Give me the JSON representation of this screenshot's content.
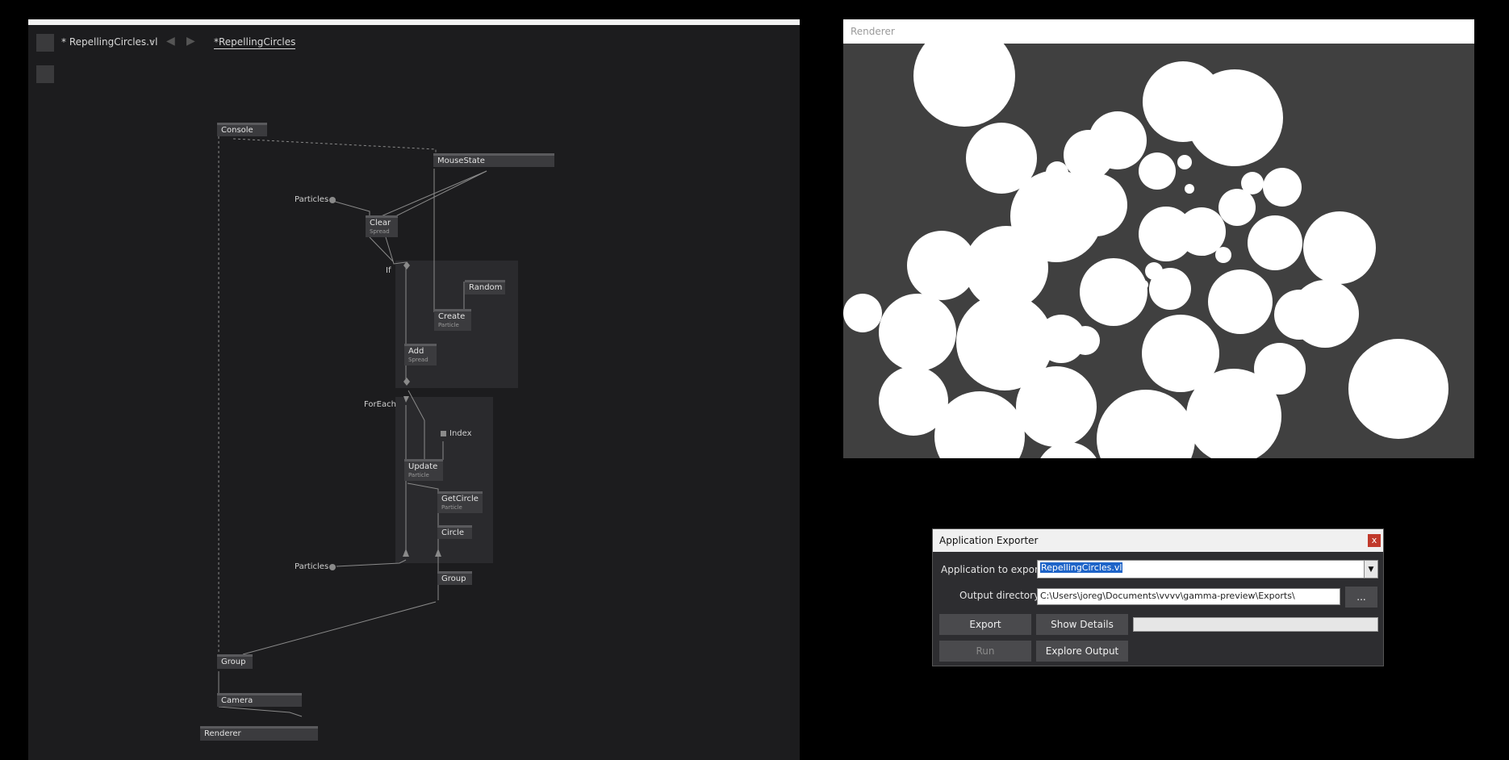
{
  "editor": {
    "tab_document": "* RepellingCircles.vl",
    "tab_dropdown": "⌄",
    "tab_patch": "*RepellingCircles",
    "back_arrow": "◀",
    "forward_arrow": "▶",
    "nodes": {
      "console": "Console",
      "mousestate": "MouseState",
      "clear": "Clear",
      "clear_sub": "Spread",
      "random": "Random",
      "create": "Create",
      "create_sub": "Particle",
      "add": "Add",
      "add_sub": "Spread",
      "update": "Update",
      "update_sub": "Particle",
      "getcircle": "GetCircle",
      "getcircle_sub": "Particle",
      "circle": "Circle",
      "group_inner": "Group",
      "group_outer": "Group",
      "camera": "Camera",
      "renderer": "Renderer"
    },
    "pads": {
      "particles_top": "Particles",
      "particles_bottom": "Particles",
      "index": "Index"
    },
    "regions": {
      "if": "If",
      "foreach": "ForEach"
    }
  },
  "renderer": {
    "title": "Renderer",
    "circles": [
      [
        150,
        40,
        63
      ],
      [
        421,
        72,
        50
      ],
      [
        340,
        120,
        36
      ],
      [
        304,
        138,
        31
      ],
      [
        485,
        92,
        60
      ],
      [
        196,
        142,
        44
      ],
      [
        264,
        214,
        57
      ],
      [
        202,
        278,
        52
      ],
      [
        122,
        275,
        43
      ],
      [
        313,
        200,
        39
      ],
      [
        389,
        158,
        23
      ],
      [
        444,
        233,
        30
      ],
      [
        488,
        203,
        23
      ],
      [
        544,
        178,
        24
      ],
      [
        535,
        247,
        34
      ],
      [
        615,
        253,
        45
      ],
      [
        400,
        236,
        34
      ],
      [
        335,
        308,
        42
      ],
      [
        405,
        304,
        26
      ],
      [
        492,
        320,
        40
      ],
      [
        565,
        336,
        31
      ],
      [
        597,
        335,
        42
      ],
      [
        92,
        358,
        48
      ],
      [
        200,
        370,
        60
      ],
      [
        270,
        366,
        30
      ],
      [
        300,
        368,
        18
      ],
      [
        418,
        384,
        48
      ],
      [
        541,
        403,
        32
      ],
      [
        688,
        428,
        62
      ],
      [
        87,
        443,
        43
      ],
      [
        264,
        450,
        50
      ],
      [
        169,
        487,
        56
      ],
      [
        375,
        490,
        61
      ],
      [
        484,
        462,
        59
      ],
      [
        279,
        534,
        40
      ],
      [
        24,
        334,
        24
      ],
      [
        249,
        189,
        17
      ],
      [
        429,
        180,
        6
      ],
      [
        262,
        178,
        8
      ],
      [
        265,
        160,
        14
      ],
      [
        423,
        147,
        9
      ],
      [
        447,
        256,
        7
      ],
      [
        471,
        262,
        10
      ],
      [
        372,
        299,
        6
      ],
      [
        531,
        172,
        6
      ],
      [
        544,
        181,
        8
      ],
      [
        550,
        192,
        7
      ],
      [
        207,
        414,
        11
      ],
      [
        385,
        282,
        11
      ],
      [
        507,
        173,
        14
      ]
    ]
  },
  "exporter": {
    "title": "Application Exporter",
    "close_label": "x",
    "app_label": "Application to export",
    "app_value": "RepellingCircles.vl",
    "dropdown_arrow": "▼",
    "outdir_label": "Output directory",
    "outdir_value": "C:\\Users\\joreg\\Documents\\vvvv\\gamma-preview\\Exports\\",
    "browse_label": "...",
    "export_label": "Export",
    "details_label": "Show Details",
    "run_label": "Run",
    "explore_label": "Explore Output"
  }
}
